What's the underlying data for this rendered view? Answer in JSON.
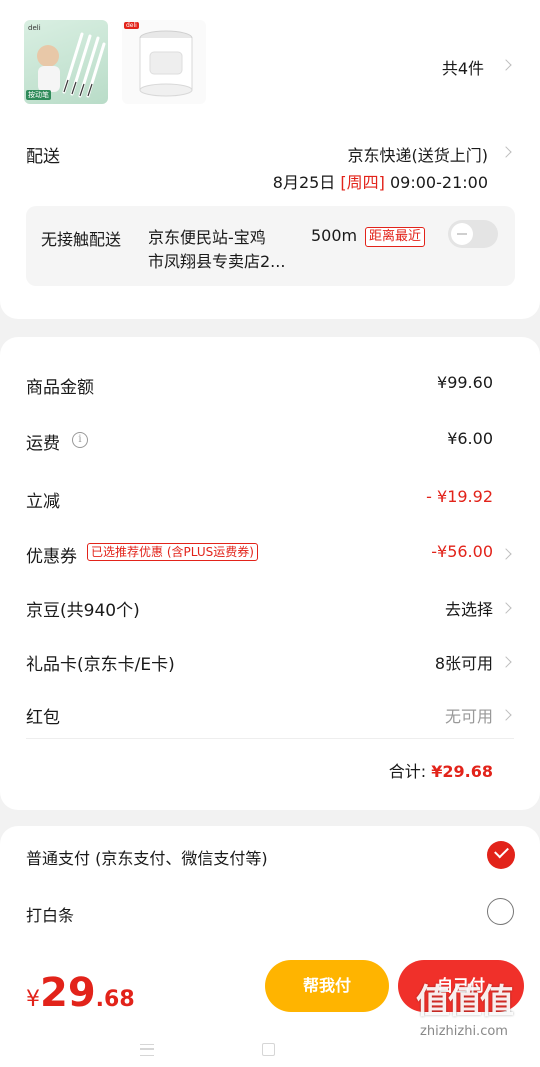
{
  "products": {
    "count_label": "共4件",
    "thumb1_brand": "deli",
    "thumb1_tag": "按动笔",
    "thumb2_brand": "deli"
  },
  "delivery": {
    "label": "配送",
    "method": "京东快递(送货上门)",
    "date": "8月25日",
    "weekday": "[周四]",
    "time": "09:00-21:00",
    "contactless_label": "无接触配送",
    "station_name": "京东便民站-宝鸡市凤翔县专卖店2...",
    "station_line1": "京东便民站-宝鸡",
    "station_line2": "市凤翔县专卖店2...",
    "distance": "500m",
    "nearest_badge": "距离最近"
  },
  "summary": {
    "goods_label": "商品金额",
    "goods_value": "¥99.60",
    "shipping_label": "运费",
    "shipping_value": "¥6.00",
    "discount_label": "立减",
    "discount_value": "- ¥19.92",
    "coupon_label": "优惠券",
    "coupon_badge": "已选推荐优惠 (含PLUS运费券)",
    "coupon_value": "-¥56.00",
    "beans_label": "京豆(共940个)",
    "beans_value": "去选择",
    "giftcard_label": "礼品卡(京东卡/E卡)",
    "giftcard_value": "8张可用",
    "redpacket_label": "红包",
    "redpacket_value": "无可用",
    "total_label": "合计:",
    "total_value": "¥29.68"
  },
  "payment": {
    "option1": "普通支付 (京东支付、微信支付等)",
    "option1_selected": true,
    "option2": "打白条",
    "option2_selected": false
  },
  "footer": {
    "currency": "¥",
    "price_int": "29",
    "price_dec": ".68",
    "help_pay": "帮我付",
    "self_pay": "自己付",
    "watermark_text": "值值值",
    "watermark_url": "zhizhizhi.com"
  },
  "colors": {
    "brand_red": "#e2231a",
    "help_pay_bg": "#ffb400",
    "self_pay_bg": "#f0302a"
  }
}
